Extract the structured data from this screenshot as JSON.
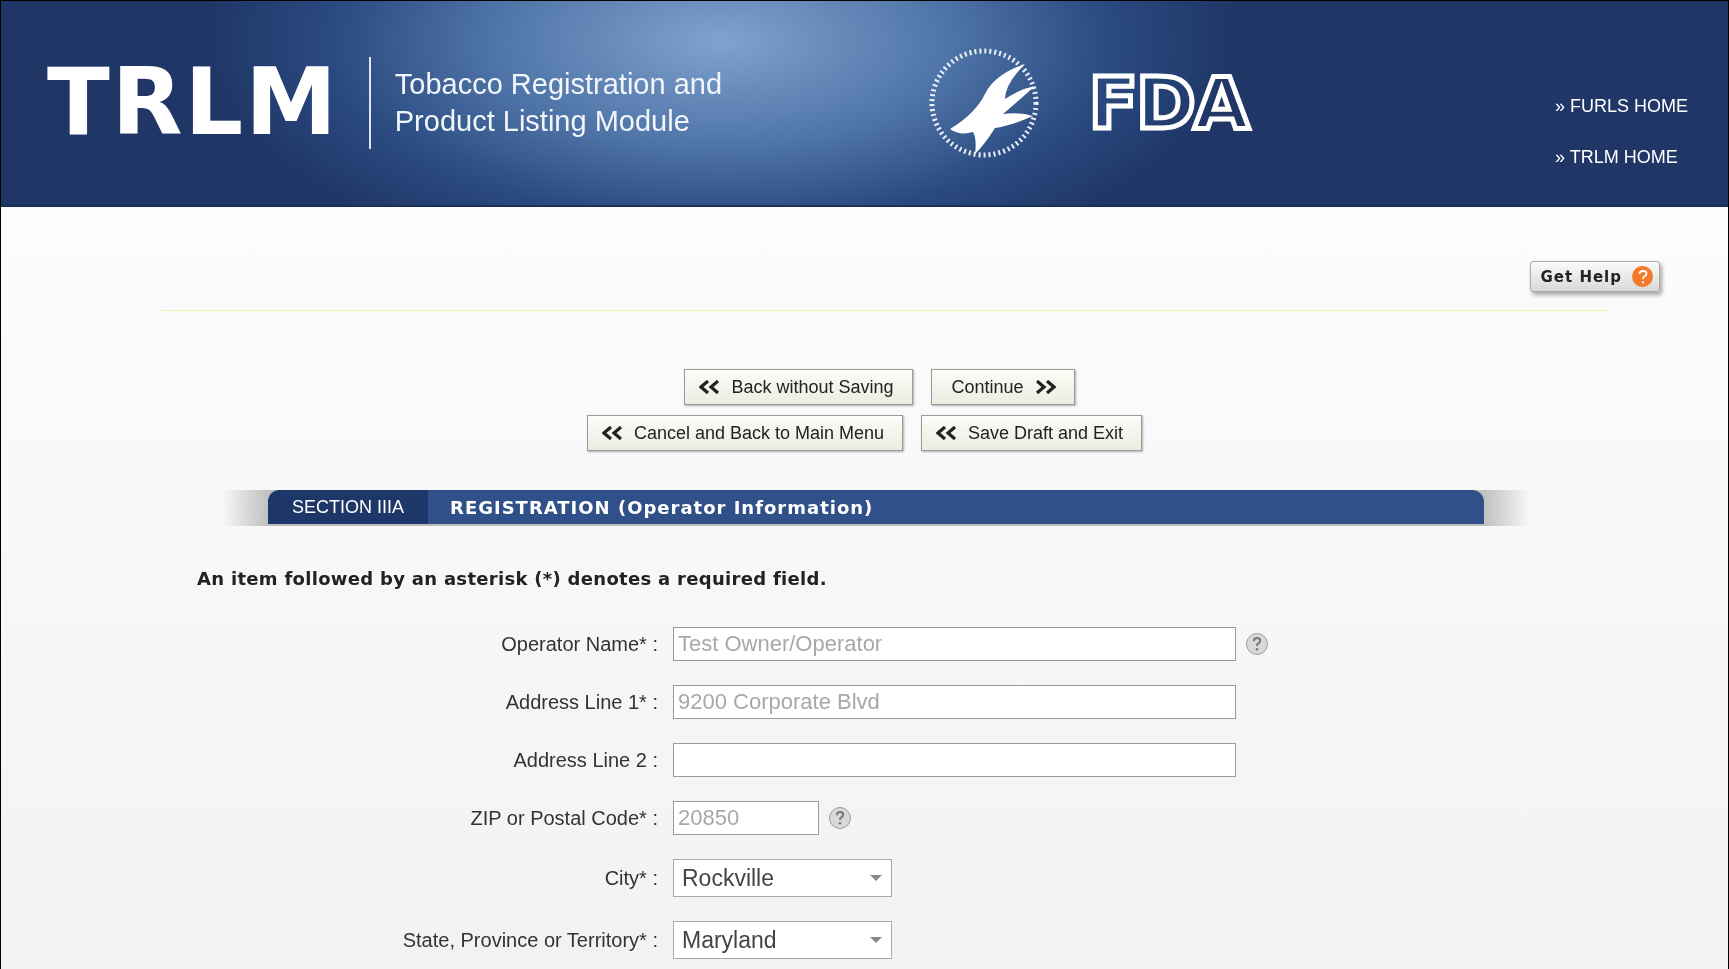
{
  "header": {
    "logo": "TRLM",
    "subtitle_lines": [
      "Tobacco Registration and",
      "Product Listing Module"
    ],
    "agency_logo": "FDA",
    "links": [
      "» FURLS HOME",
      "» TRLM HOME"
    ]
  },
  "help_button": "Get Help",
  "buttons": [
    {
      "label": "Back without Saving",
      "kind": "back"
    },
    {
      "label": "Continue",
      "kind": "forward"
    },
    {
      "label": "Cancel and Back to Main Menu",
      "kind": "back"
    },
    {
      "label": "Save Draft and Exit",
      "kind": "back"
    }
  ],
  "section": {
    "tab": "SECTION IIIA",
    "title": "REGISTRATION (Operator Information)"
  },
  "required_note": "An item followed by an asterisk (*) denotes a required field.",
  "fields": [
    {
      "label": "Operator Name* :",
      "kind": "text",
      "value": "Test Owner/Operator",
      "disabled": true,
      "help": true
    },
    {
      "label": "Address Line 1* :",
      "kind": "text",
      "value": "9200 Corporate Blvd",
      "disabled": true,
      "help": false
    },
    {
      "label": "Address Line 2 :",
      "kind": "text",
      "help": false
    },
    {
      "label": "ZIP or Postal Code* :",
      "kind": "postal",
      "value": "20850",
      "disabled": true,
      "help": true
    },
    {
      "label": "City* :",
      "kind": "select",
      "value": "Rockville",
      "disabled": false,
      "help": false
    },
    {
      "label": "State, Province or Territory* :",
      "kind": "select",
      "value": "Maryland",
      "disabled": false,
      "help": false
    }
  ]
}
